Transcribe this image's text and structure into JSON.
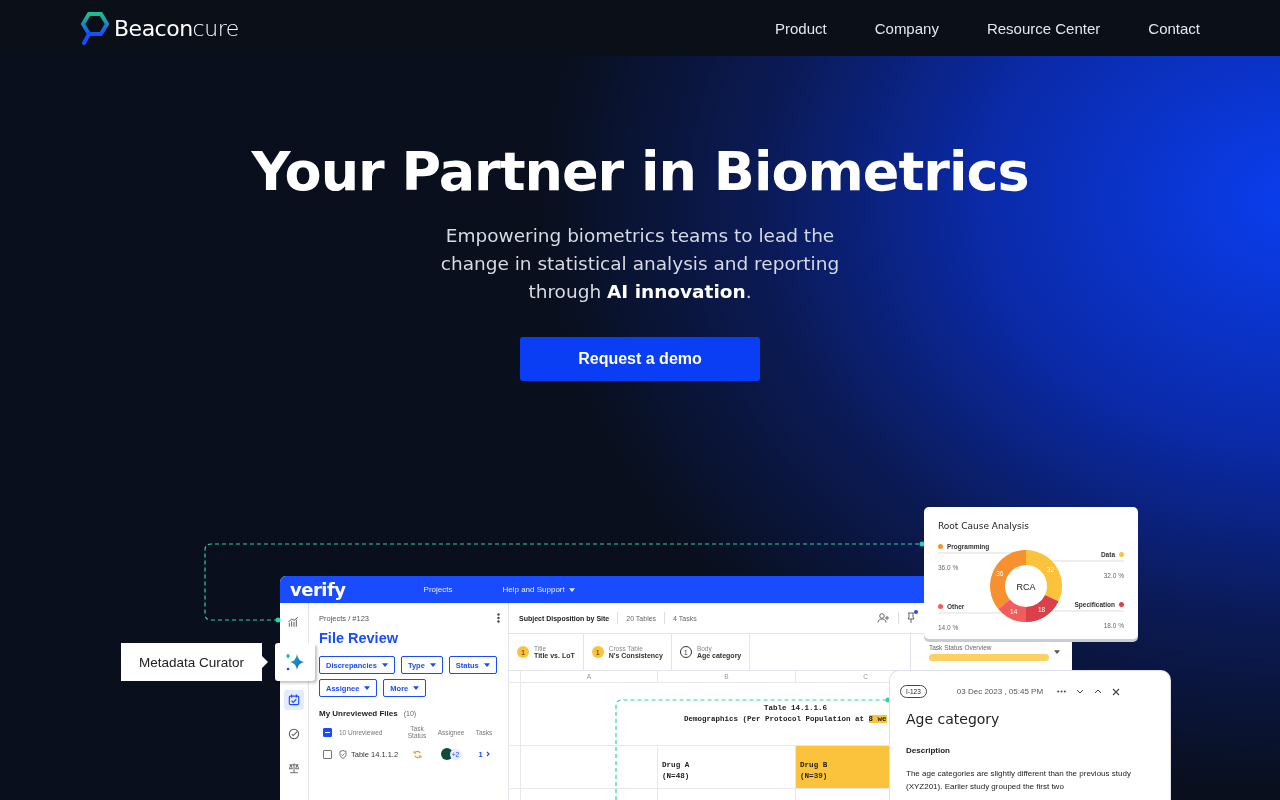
{
  "header": {
    "logo": "**Beacon**cure",
    "nav": [
      {
        "label": "Product"
      },
      {
        "label": "Company"
      },
      {
        "label": "Resource Center"
      },
      {
        "label": "Contact"
      }
    ]
  },
  "hero": {
    "title": "Your Partner in Biometrics",
    "subtitle": "Empowering biometrics teams to lead the change in statistical analysis and reporting through **AI innovation**.",
    "cta": "Request a demo"
  },
  "callout": {
    "label": "Metadata Curator"
  },
  "app": {
    "logo": "verify",
    "nav": [
      {
        "label": "Projects",
        "dropdown": false
      },
      {
        "label": "Help and Support",
        "dropdown": true
      }
    ],
    "rail": [
      {
        "kind": "chart",
        "selected": false
      },
      {
        "kind": "calendar",
        "selected": true
      },
      {
        "kind": "check",
        "selected": false
      },
      {
        "kind": "scale",
        "selected": false
      }
    ],
    "breadcrumb": "Projects / #123",
    "page_title": "File Review",
    "filters": [
      "Discrepancies",
      "Type",
      "Status",
      "Assignee",
      "More"
    ],
    "list_title": "My Unreviewed Files",
    "list_count": "(10)",
    "select_all_indeterminate": true,
    "list_columns": [
      "10 Unreviewed",
      "Task Status",
      "Assignee",
      "Tasks"
    ],
    "files": [
      {
        "name": "Table 14.1.1.2",
        "checked": false,
        "assignee_extra": "+2",
        "tasks": "1"
      }
    ],
    "toolbar": {
      "title": "Subject Disposition by Site",
      "tables": "20 Tables",
      "tasks": "4 Tasks",
      "pin_unread": true
    },
    "checks": [
      {
        "count": "1",
        "category": "Title",
        "name": "Title vs. LoT",
        "kind": "flagged"
      },
      {
        "count": "1",
        "category": "Cross Table",
        "name": "N's Consistency",
        "kind": "flagged"
      },
      {
        "count": "1",
        "category": "Body",
        "name": "Age category",
        "kind": "open"
      }
    ],
    "task_status": {
      "label": "Task Status Overview"
    },
    "sheet": {
      "columns": [
        "A",
        "B",
        "C"
      ],
      "title": "Table 14.1.1.6",
      "subtitle": "Demographics (Per Protocol Population at ",
      "highlight": "8 we",
      "groups": [
        {
          "name": "Drug A",
          "n": "(N=48)",
          "highlighted": false
        },
        {
          "name": "Drug B",
          "n": "(N=39)",
          "highlighted": true
        }
      ]
    }
  },
  "rca": {
    "title": "Root Cause Analysis",
    "legend": [
      {
        "percent": "36.0 %",
        "color": "#f7902f"
      },
      {
        "percent": "32.0 %",
        "color": "#fbc23c"
      },
      {
        "percent": "14.0 %",
        "color": "#f25c5c"
      },
      {
        "percent": "18.0 %",
        "color": "#d9404a"
      }
    ],
    "chart_data": {
      "type": "donut",
      "categories": [
        "Programming",
        "Data",
        "Other",
        "Specification"
      ],
      "series": [
        {
          "name": "RCA",
          "values": [
            36,
            32,
            14,
            18
          ]
        }
      ],
      "data_labels": true
    }
  },
  "issue": {
    "id": "I-123",
    "date": "03 Dec 2023 , 05:45 PM",
    "title": "Age category",
    "section": "Description",
    "text": "The age categories are slightly different than the previous study (XYZ201). Earlier study grouped the first two"
  }
}
